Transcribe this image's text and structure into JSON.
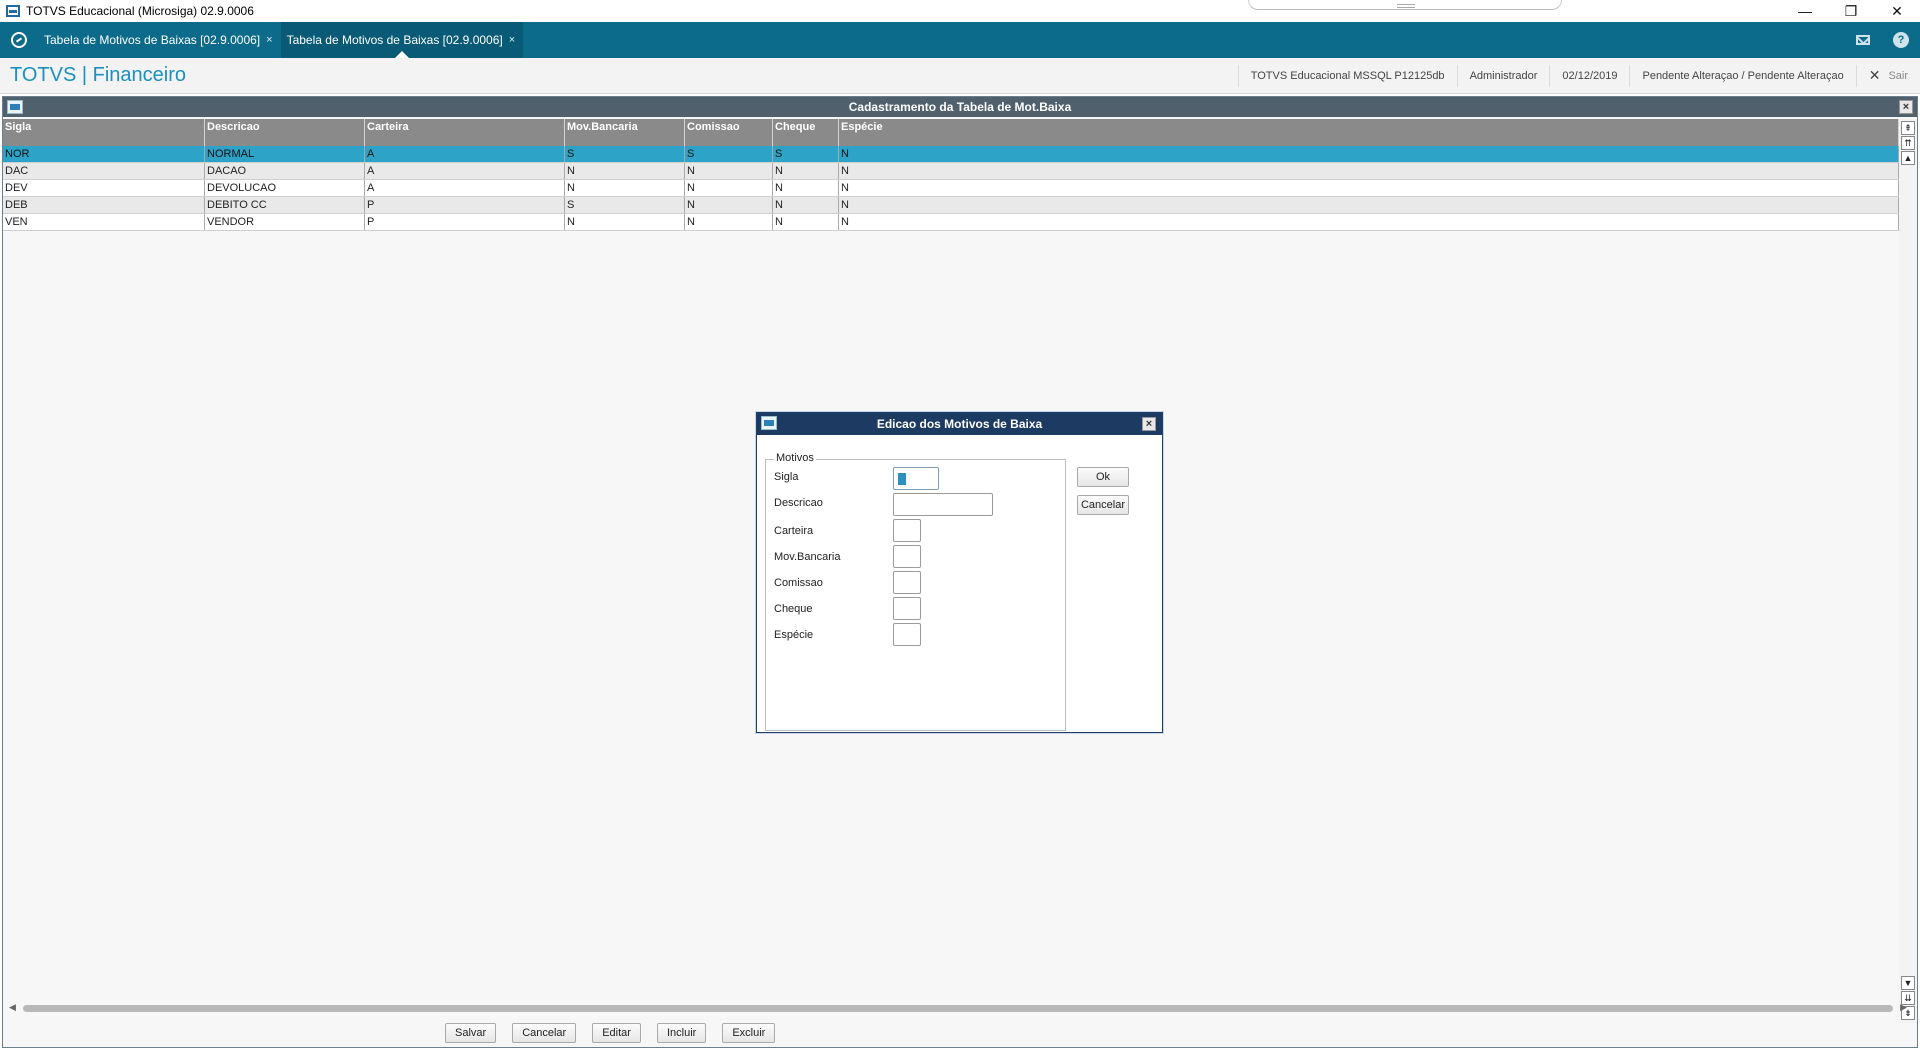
{
  "window": {
    "title": "TOTVS Educacional (Microsiga) 02.9.0006",
    "minimize": "—",
    "restore": "❐",
    "close": "✕"
  },
  "tabs": [
    {
      "label": "Tabela de Motivos de Baixas [02.9.0006]",
      "close": "×"
    },
    {
      "label": "Tabela de Motivos de Baixas [02.9.0006]",
      "close": "×"
    }
  ],
  "header": {
    "brand": "TOTVS | Financeiro",
    "environment": "TOTVS Educacional MSSQL P12125db",
    "user": "Administrador",
    "date": "02/12/2019",
    "status": "Pendente Alteraçao / Pendente Alteraçao",
    "exit_label": "Sair",
    "exit_x": "✕"
  },
  "main_window": {
    "title": "Cadastramento da Tabela de Mot.Baixa",
    "close": "×"
  },
  "grid": {
    "columns": [
      "Sigla",
      "Descricao",
      "Carteira",
      "Mov.Bancaria",
      "Comissao",
      "Cheque",
      "Espécie"
    ],
    "rows": [
      [
        "NOR",
        "NORMAL",
        "A",
        "S",
        "S",
        "S",
        "N"
      ],
      [
        "DAC",
        "DACAO",
        "A",
        "N",
        "N",
        "N",
        "N"
      ],
      [
        "DEV",
        "DEVOLUCAO",
        "A",
        "N",
        "N",
        "N",
        "N"
      ],
      [
        "DEB",
        "DEBITO CC",
        "P",
        "S",
        "N",
        "N",
        "N"
      ],
      [
        "VEN",
        "VENDOR",
        "P",
        "N",
        "N",
        "N",
        "N"
      ]
    ],
    "selected_row": 0
  },
  "scroll": {
    "top": "⇞",
    "up_page": "⇈",
    "up": "▲",
    "down": "▼",
    "down_page": "⇊",
    "bottom": "⇟",
    "left": "◀",
    "right": "▶"
  },
  "bottom_buttons": {
    "save": "Salvar",
    "cancel": "Cancelar",
    "edit": "Editar",
    "include": "Incluir",
    "delete": "Excluir"
  },
  "dialog": {
    "title": "Edicao dos Motivos de Baixa",
    "close": "×",
    "group": "Motivos",
    "fields": {
      "sigla": {
        "label": "Sigla",
        "value": ""
      },
      "descricao": {
        "label": "Descricao",
        "value": ""
      },
      "carteira": {
        "label": "Carteira",
        "value": ""
      },
      "mov_bancaria": {
        "label": "Mov.Bancaria",
        "value": ""
      },
      "comissao": {
        "label": "Comissao",
        "value": ""
      },
      "cheque": {
        "label": "Cheque",
        "value": ""
      },
      "especie": {
        "label": "Espécie",
        "value": ""
      }
    },
    "ok": "Ok",
    "cancel": "Cancelar"
  },
  "colors": {
    "tabbar": "#0c6b8b",
    "brand": "#1b8fbd",
    "grid_header": "#8a8a8a",
    "selected_row": "#2ea3c8",
    "dialog_title": "#1d3a63"
  }
}
